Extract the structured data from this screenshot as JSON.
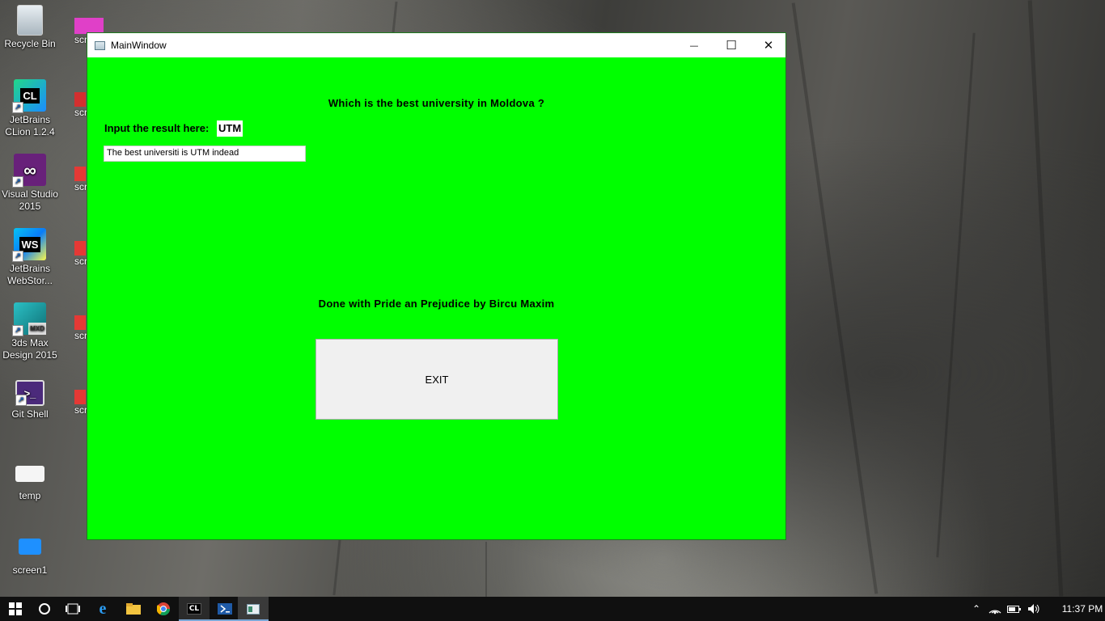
{
  "desktop": {
    "icons": [
      {
        "label": "Recycle Bin",
        "icon": "recycle-bin-icon"
      },
      {
        "label": "JetBrains CLion 1.2.4",
        "icon": "clion-icon",
        "badge": "CL"
      },
      {
        "label": "Visual Studio 2015",
        "icon": "visual-studio-icon"
      },
      {
        "label": "JetBrains WebStor...",
        "icon": "webstorm-icon",
        "badge": "WS"
      },
      {
        "label": "3ds Max Design 2015",
        "icon": "3ds-max-icon",
        "badge": "MXD"
      },
      {
        "label": "Git Shell",
        "icon": "git-shell-icon"
      },
      {
        "label": "temp",
        "icon": "folder-icon"
      },
      {
        "label": "screen1",
        "icon": "folder-icon"
      }
    ],
    "partial_label": "scr"
  },
  "window": {
    "title": "MainWindow",
    "minimize_glyph": "—",
    "maximize_glyph": "☐",
    "close_glyph": "✕",
    "background": "#00ff00"
  },
  "form": {
    "question": "Which is the best university in Moldova ?",
    "input_label": "Input the result here:",
    "result_value": "UTM",
    "text_field_value": "The best universiti is UTM indead",
    "credits": "Done with Pride an Prejudice by Bircu Maxim",
    "exit_label": "EXIT"
  },
  "taskbar": {
    "clion_badge": "CL",
    "clock": "11:37 PM"
  }
}
